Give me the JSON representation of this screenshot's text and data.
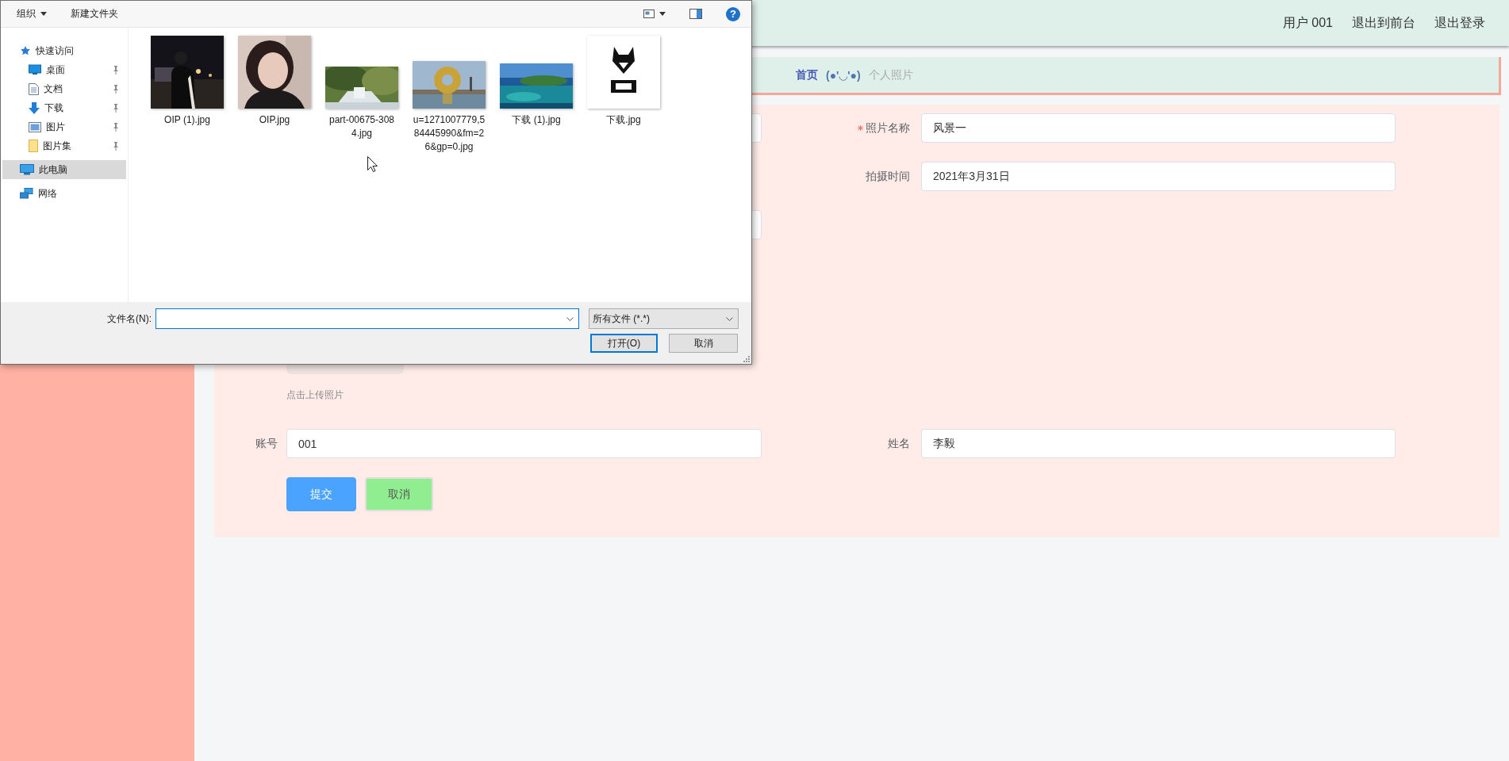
{
  "header": {
    "links": [
      "用户 001",
      "退出到前台",
      "退出登录"
    ]
  },
  "breadcrumb": {
    "home": "首页",
    "separator": "(●'◡'●)",
    "current": "个人照片"
  },
  "form": {
    "rows": [
      {
        "left": {
          "kind": "field"
        },
        "right": {
          "kind": "field",
          "label": "照片名称",
          "required": true,
          "value": "风景一"
        }
      },
      {
        "right": {
          "kind": "field",
          "label": "拍摄时间",
          "required": false,
          "value": "2021年3月31日"
        }
      },
      {
        "left": {
          "kind": "field"
        }
      }
    ],
    "upload": {
      "hint": "点击上传照片"
    },
    "account_row": {
      "left": {
        "kind": "field",
        "label": "账号",
        "required": false,
        "value": "001"
      },
      "right": {
        "kind": "field",
        "label": "姓名",
        "required": false,
        "value": "李毅"
      }
    },
    "buttons": [
      {
        "label": "提交",
        "kind": "primary"
      },
      {
        "label": "取消",
        "kind": "success"
      }
    ]
  },
  "file_dialog": {
    "toolbar": {
      "organize": "组织",
      "new_folder": "新建文件夹",
      "help": "?"
    },
    "nav": [
      {
        "label": "快速访问",
        "kind": "star",
        "selected": false,
        "children": [
          {
            "label": "桌面",
            "kind": "desktop",
            "pinned": true,
            "selected": false
          },
          {
            "label": "文档",
            "kind": "document",
            "pinned": true,
            "selected": false
          },
          {
            "label": "下载",
            "kind": "download",
            "pinned": true,
            "selected": false
          },
          {
            "label": "图片",
            "kind": "pictures",
            "pinned": true,
            "selected": false
          },
          {
            "label": "图片集",
            "kind": "folder",
            "pinned": true,
            "selected": false
          }
        ]
      },
      {
        "label": "此电脑",
        "kind": "computer",
        "selected": true
      },
      {
        "label": "网络",
        "kind": "network",
        "selected": false
      }
    ],
    "files": [
      {
        "name": "OIP (1).jpg",
        "kind": "picture"
      },
      {
        "name": "OIP.jpg",
        "kind": "picture"
      },
      {
        "name": "part-00675-3084.jpg",
        "kind": "picture"
      },
      {
        "name": "u=1271007779,584445990&fm=26&gp=0.jpg",
        "kind": "picture"
      },
      {
        "name": "下载 (1).jpg",
        "kind": "picture"
      },
      {
        "name": "下载.jpg",
        "kind": "picture"
      }
    ],
    "filename_label": "文件名(N):",
    "filetype": "所有文件 (*.*)",
    "buttons": [
      {
        "label": "打开(O)",
        "default": true
      },
      {
        "label": "取消",
        "default": false
      }
    ]
  }
}
